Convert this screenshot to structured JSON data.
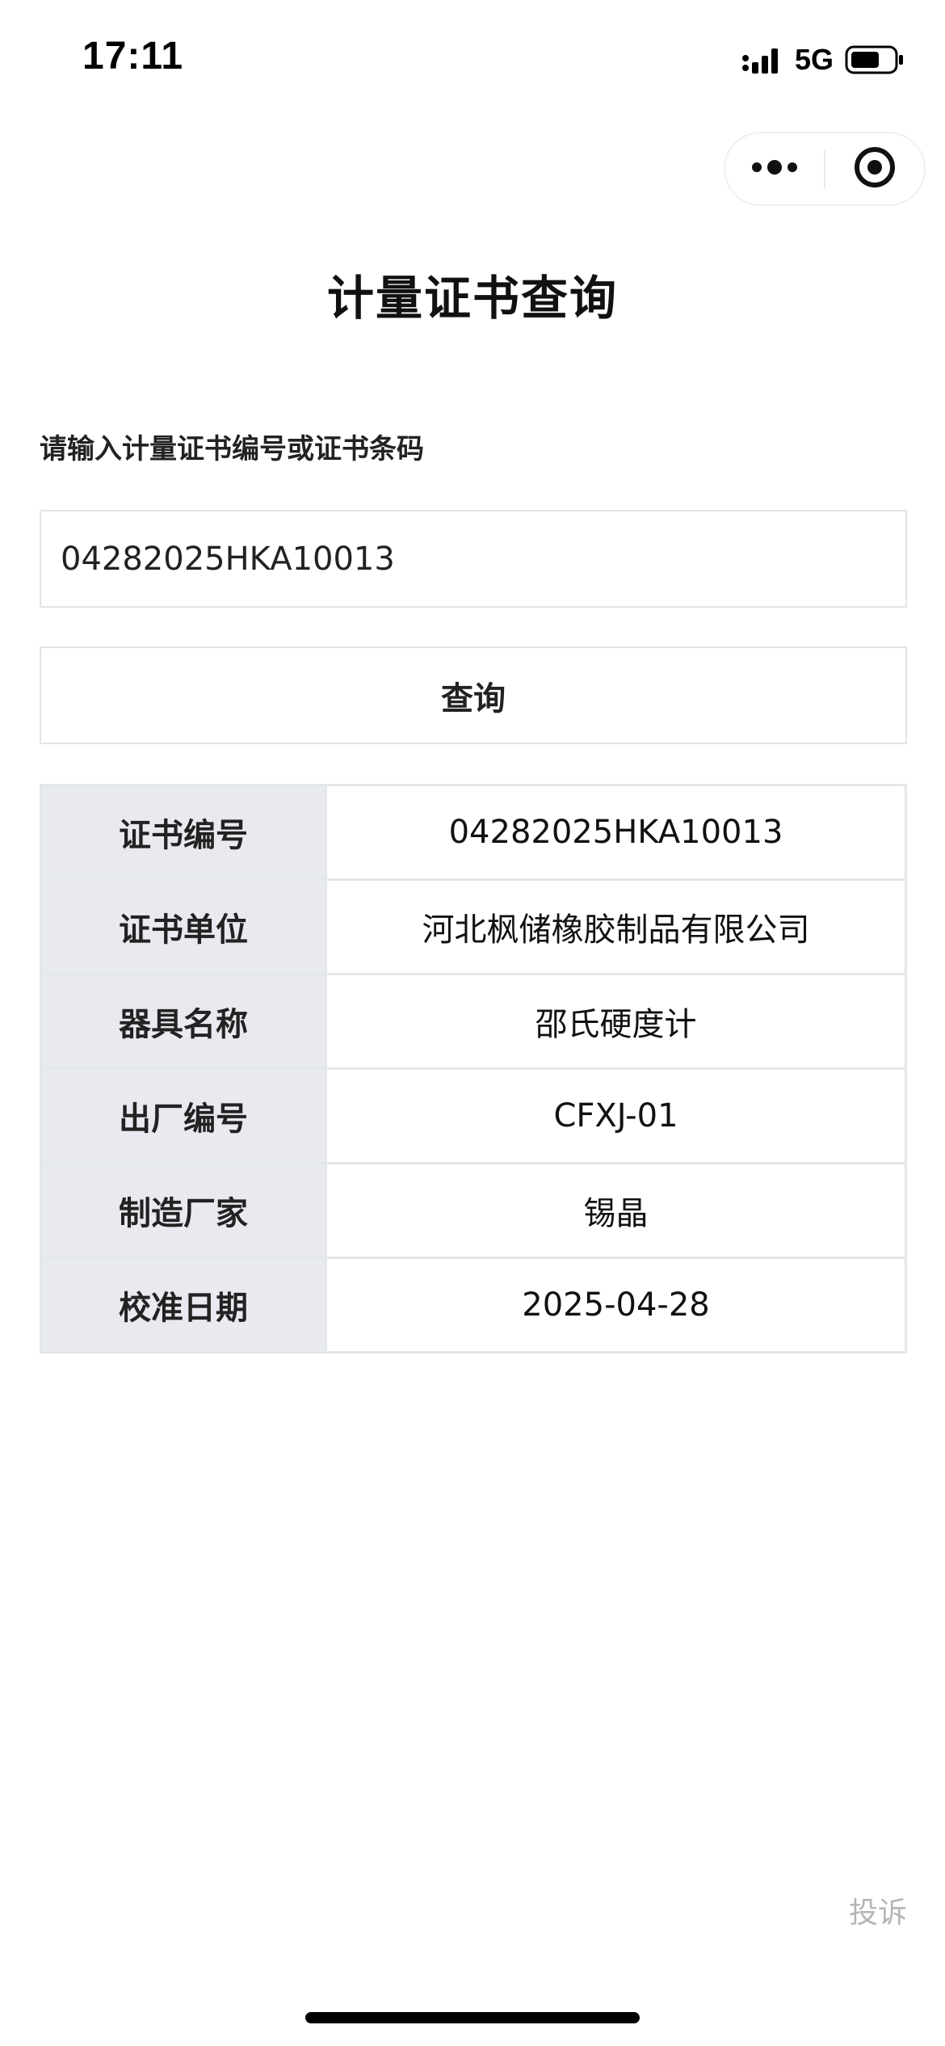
{
  "status_bar": {
    "time": "17:11",
    "network": "5G"
  },
  "capsule": {
    "more_icon": "more-dots-icon",
    "close_icon": "target-close-icon"
  },
  "page": {
    "title": "计量证书查询",
    "prompt": "请输入计量证书编号或证书条码",
    "input_value": "04282025HKA10013",
    "query_button": "查询"
  },
  "result": {
    "rows": [
      {
        "key": "证书编号",
        "value": "04282025HKA10013"
      },
      {
        "key": "证书单位",
        "value": "河北枫储橡胶制品有限公司"
      },
      {
        "key": "器具名称",
        "value": "邵氏硬度计"
      },
      {
        "key": "出厂编号",
        "value": "CFXJ-01"
      },
      {
        "key": "制造厂家",
        "value": "锡晶"
      },
      {
        "key": "校准日期",
        "value": "2025-04-28"
      }
    ]
  },
  "footer": {
    "complaint": "投诉"
  }
}
